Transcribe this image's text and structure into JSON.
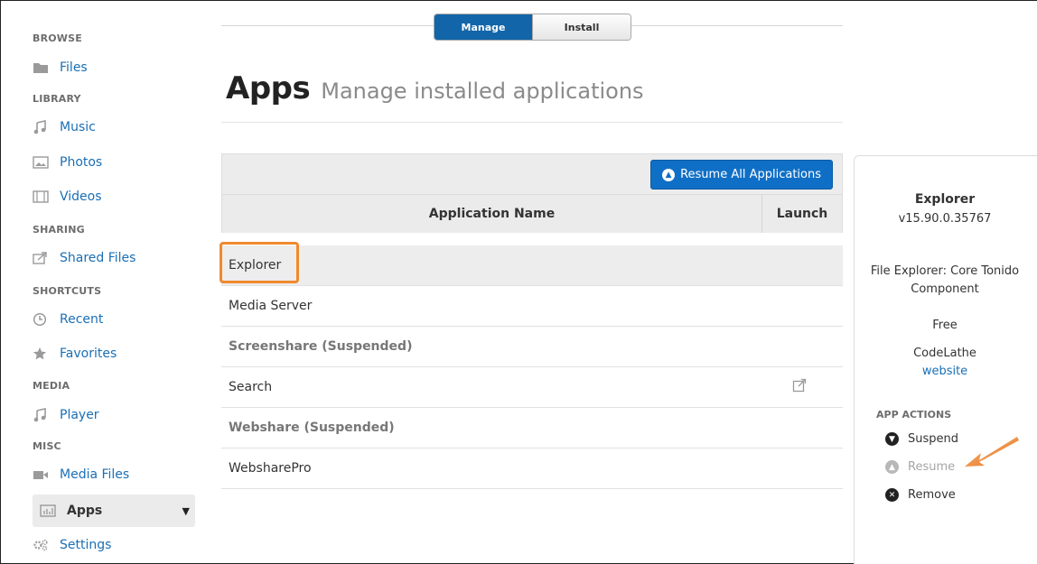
{
  "sidebar": {
    "sections": [
      {
        "label": "BROWSE"
      },
      {
        "label": "LIBRARY"
      },
      {
        "label": "SHARING"
      },
      {
        "label": "SHORTCUTS"
      },
      {
        "label": "MEDIA"
      },
      {
        "label": "MISC"
      }
    ],
    "items": [
      {
        "label": "Files",
        "icon": "folder-icon"
      },
      {
        "label": "Music",
        "icon": "music-note-icon"
      },
      {
        "label": "Photos",
        "icon": "image-icon"
      },
      {
        "label": "Videos",
        "icon": "film-icon"
      },
      {
        "label": "Shared Files",
        "icon": "share-icon"
      },
      {
        "label": "Recent",
        "icon": "clock-icon"
      },
      {
        "label": "Favorites",
        "icon": "star-icon"
      },
      {
        "label": "Player",
        "icon": "music-note-icon"
      },
      {
        "label": "Media Files",
        "icon": "video-camera-icon"
      },
      {
        "label": "Apps",
        "icon": "bar-chart-icon",
        "active": true
      },
      {
        "label": "Settings",
        "icon": "gears-icon"
      }
    ]
  },
  "tabs": {
    "manage": "Manage",
    "install": "Install",
    "active": "Manage"
  },
  "header": {
    "title": "Apps",
    "subtitle": "Manage installed applications"
  },
  "toolbar": {
    "resume_all": "Resume All Applications"
  },
  "table": {
    "columns": [
      "Application Name",
      "Launch"
    ],
    "rows": [
      {
        "name": "Explorer",
        "selected": true,
        "suspended": false,
        "launch": false
      },
      {
        "name": "Media Server",
        "selected": false,
        "suspended": false,
        "launch": false
      },
      {
        "name": "Screenshare (Suspended)",
        "selected": false,
        "suspended": true,
        "launch": false
      },
      {
        "name": "Search",
        "selected": false,
        "suspended": false,
        "launch": true
      },
      {
        "name": "Webshare (Suspended)",
        "selected": false,
        "suspended": true,
        "launch": false
      },
      {
        "name": "WebsharePro",
        "selected": false,
        "suspended": false,
        "launch": false
      }
    ]
  },
  "details": {
    "name": "Explorer",
    "version": "v15.90.0.35767",
    "description_line1": "File Explorer: Core Tonido",
    "description_line2": "Component",
    "price": "Free",
    "vendor": "CodeLathe",
    "website": "website",
    "actions_heading": "APP ACTIONS",
    "actions": [
      {
        "label": "Suspend",
        "enabled": true,
        "icon": "circle-down-icon"
      },
      {
        "label": "Resume",
        "enabled": false,
        "icon": "circle-up-icon"
      },
      {
        "label": "Remove",
        "enabled": true,
        "icon": "circle-x-icon"
      }
    ]
  },
  "colors": {
    "accent": "#1265a8",
    "link": "#1a6fb5",
    "highlight": "#f08a2c"
  }
}
